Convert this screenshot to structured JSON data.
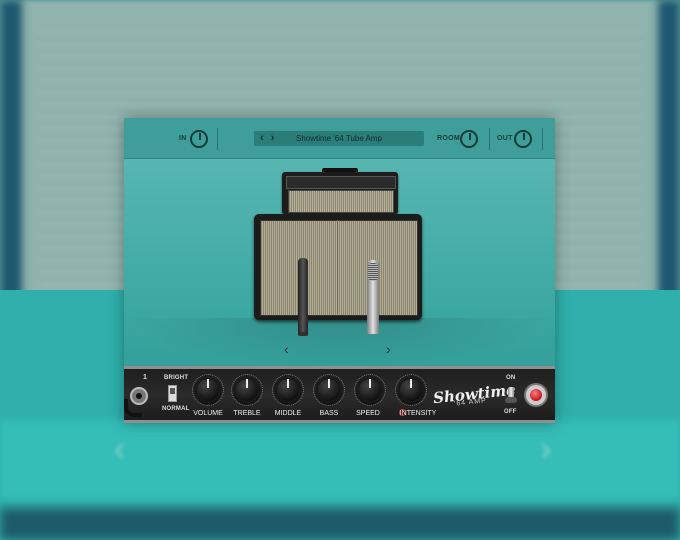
{
  "topbar": {
    "in_label": "IN",
    "preset_arrows": "‹ ›",
    "preset_name": "Showtime '64 Tube Amp",
    "room_label": "ROOM",
    "out_label": "OUT"
  },
  "mic_nav": {
    "prev": "‹",
    "next": "›"
  },
  "amp": {
    "channel_number": "1",
    "bright_label": "BRIGHT",
    "normal_label": "NORMAL",
    "knobs": [
      {
        "label": "VOLUME"
      },
      {
        "label": "TREBLE"
      },
      {
        "label": "MIDDLE"
      },
      {
        "label": "BASS"
      },
      {
        "label": "SPEED"
      },
      {
        "label": "INTENSITY"
      }
    ],
    "logo": "Showtime",
    "logo_sub": "'64 AMP",
    "on_label": "ON",
    "off_label": "OFF"
  },
  "colors": {
    "accent": "#3ea8a3",
    "power_light": "#c4161c"
  }
}
